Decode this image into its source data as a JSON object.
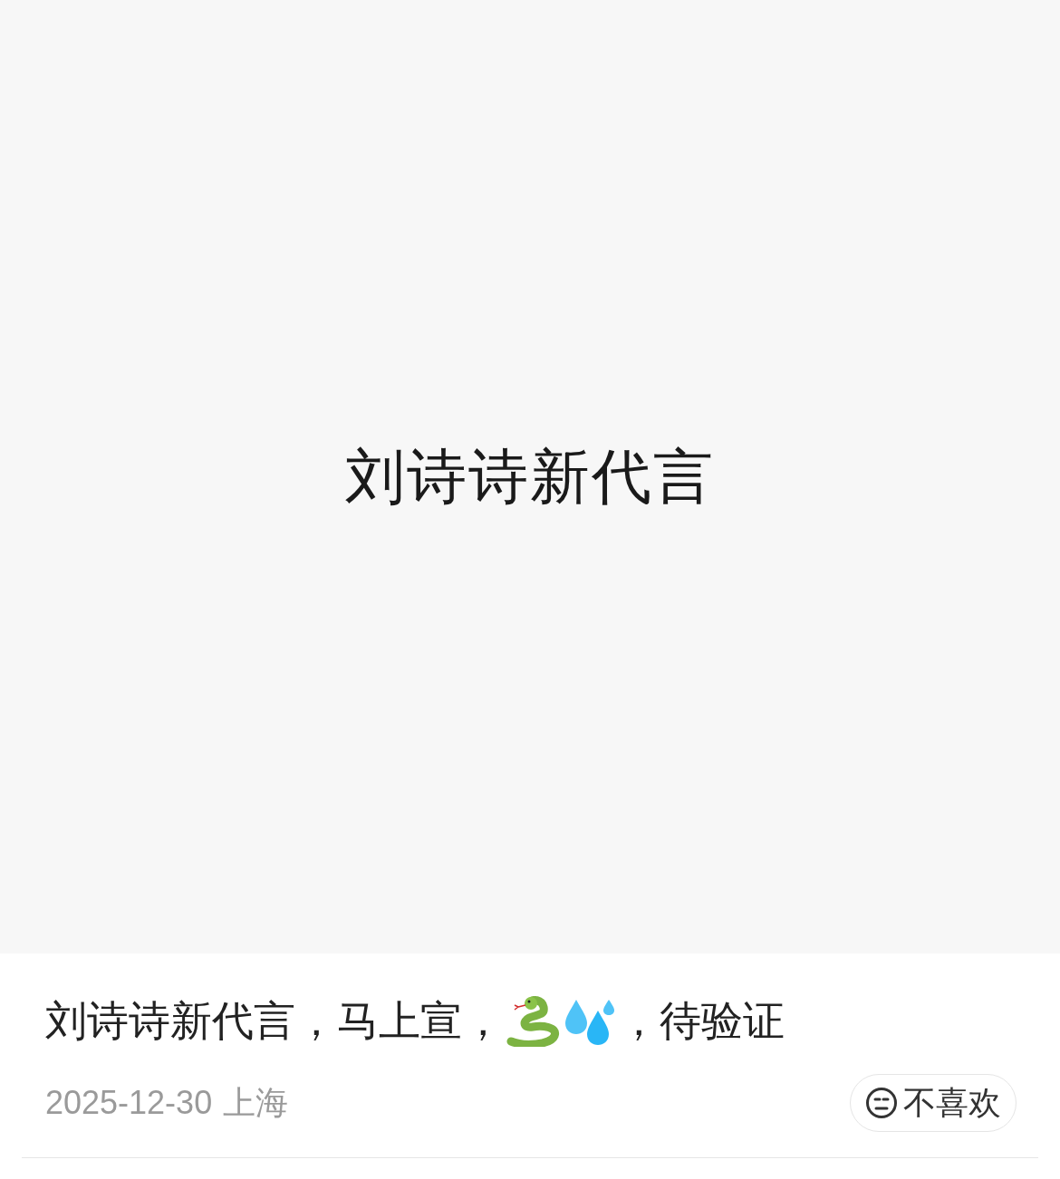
{
  "cover": {
    "text": "刘诗诗新代言"
  },
  "title": {
    "before": "刘诗诗新代言，马上宣，",
    "after": "，待验证"
  },
  "meta": {
    "date": "2025-12-30",
    "location": "上海"
  },
  "dislike_button": {
    "label": "不喜欢"
  }
}
